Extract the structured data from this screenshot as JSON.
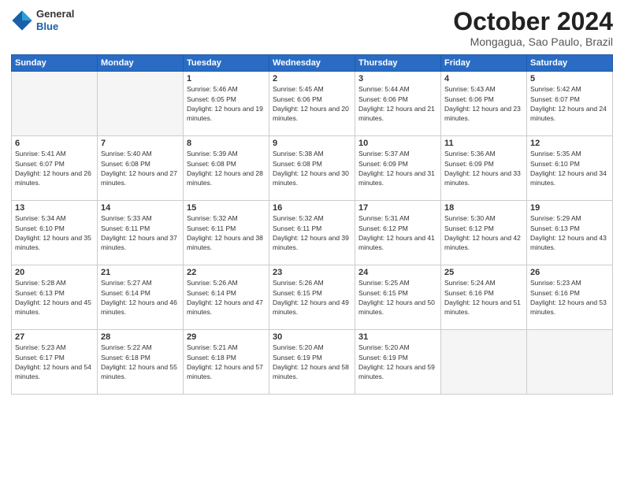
{
  "header": {
    "logo_general": "General",
    "logo_blue": "Blue",
    "month": "October 2024",
    "location": "Mongagua, Sao Paulo, Brazil"
  },
  "days_of_week": [
    "Sunday",
    "Monday",
    "Tuesday",
    "Wednesday",
    "Thursday",
    "Friday",
    "Saturday"
  ],
  "weeks": [
    [
      {
        "day": "",
        "empty": true
      },
      {
        "day": "",
        "empty": true
      },
      {
        "day": "1",
        "sunrise": "5:46 AM",
        "sunset": "6:05 PM",
        "daylight": "12 hours and 19 minutes."
      },
      {
        "day": "2",
        "sunrise": "5:45 AM",
        "sunset": "6:06 PM",
        "daylight": "12 hours and 20 minutes."
      },
      {
        "day": "3",
        "sunrise": "5:44 AM",
        "sunset": "6:06 PM",
        "daylight": "12 hours and 21 minutes."
      },
      {
        "day": "4",
        "sunrise": "5:43 AM",
        "sunset": "6:06 PM",
        "daylight": "12 hours and 23 minutes."
      },
      {
        "day": "5",
        "sunrise": "5:42 AM",
        "sunset": "6:07 PM",
        "daylight": "12 hours and 24 minutes."
      }
    ],
    [
      {
        "day": "6",
        "sunrise": "5:41 AM",
        "sunset": "6:07 PM",
        "daylight": "12 hours and 26 minutes."
      },
      {
        "day": "7",
        "sunrise": "5:40 AM",
        "sunset": "6:08 PM",
        "daylight": "12 hours and 27 minutes."
      },
      {
        "day": "8",
        "sunrise": "5:39 AM",
        "sunset": "6:08 PM",
        "daylight": "12 hours and 28 minutes."
      },
      {
        "day": "9",
        "sunrise": "5:38 AM",
        "sunset": "6:08 PM",
        "daylight": "12 hours and 30 minutes."
      },
      {
        "day": "10",
        "sunrise": "5:37 AM",
        "sunset": "6:09 PM",
        "daylight": "12 hours and 31 minutes."
      },
      {
        "day": "11",
        "sunrise": "5:36 AM",
        "sunset": "6:09 PM",
        "daylight": "12 hours and 33 minutes."
      },
      {
        "day": "12",
        "sunrise": "5:35 AM",
        "sunset": "6:10 PM",
        "daylight": "12 hours and 34 minutes."
      }
    ],
    [
      {
        "day": "13",
        "sunrise": "5:34 AM",
        "sunset": "6:10 PM",
        "daylight": "12 hours and 35 minutes."
      },
      {
        "day": "14",
        "sunrise": "5:33 AM",
        "sunset": "6:11 PM",
        "daylight": "12 hours and 37 minutes."
      },
      {
        "day": "15",
        "sunrise": "5:32 AM",
        "sunset": "6:11 PM",
        "daylight": "12 hours and 38 minutes."
      },
      {
        "day": "16",
        "sunrise": "5:32 AM",
        "sunset": "6:11 PM",
        "daylight": "12 hours and 39 minutes."
      },
      {
        "day": "17",
        "sunrise": "5:31 AM",
        "sunset": "6:12 PM",
        "daylight": "12 hours and 41 minutes."
      },
      {
        "day": "18",
        "sunrise": "5:30 AM",
        "sunset": "6:12 PM",
        "daylight": "12 hours and 42 minutes."
      },
      {
        "day": "19",
        "sunrise": "5:29 AM",
        "sunset": "6:13 PM",
        "daylight": "12 hours and 43 minutes."
      }
    ],
    [
      {
        "day": "20",
        "sunrise": "5:28 AM",
        "sunset": "6:13 PM",
        "daylight": "12 hours and 45 minutes."
      },
      {
        "day": "21",
        "sunrise": "5:27 AM",
        "sunset": "6:14 PM",
        "daylight": "12 hours and 46 minutes."
      },
      {
        "day": "22",
        "sunrise": "5:26 AM",
        "sunset": "6:14 PM",
        "daylight": "12 hours and 47 minutes."
      },
      {
        "day": "23",
        "sunrise": "5:26 AM",
        "sunset": "6:15 PM",
        "daylight": "12 hours and 49 minutes."
      },
      {
        "day": "24",
        "sunrise": "5:25 AM",
        "sunset": "6:15 PM",
        "daylight": "12 hours and 50 minutes."
      },
      {
        "day": "25",
        "sunrise": "5:24 AM",
        "sunset": "6:16 PM",
        "daylight": "12 hours and 51 minutes."
      },
      {
        "day": "26",
        "sunrise": "5:23 AM",
        "sunset": "6:16 PM",
        "daylight": "12 hours and 53 minutes."
      }
    ],
    [
      {
        "day": "27",
        "sunrise": "5:23 AM",
        "sunset": "6:17 PM",
        "daylight": "12 hours and 54 minutes."
      },
      {
        "day": "28",
        "sunrise": "5:22 AM",
        "sunset": "6:18 PM",
        "daylight": "12 hours and 55 minutes."
      },
      {
        "day": "29",
        "sunrise": "5:21 AM",
        "sunset": "6:18 PM",
        "daylight": "12 hours and 57 minutes."
      },
      {
        "day": "30",
        "sunrise": "5:20 AM",
        "sunset": "6:19 PM",
        "daylight": "12 hours and 58 minutes."
      },
      {
        "day": "31",
        "sunrise": "5:20 AM",
        "sunset": "6:19 PM",
        "daylight": "12 hours and 59 minutes."
      },
      {
        "day": "",
        "empty": true
      },
      {
        "day": "",
        "empty": true
      }
    ]
  ]
}
